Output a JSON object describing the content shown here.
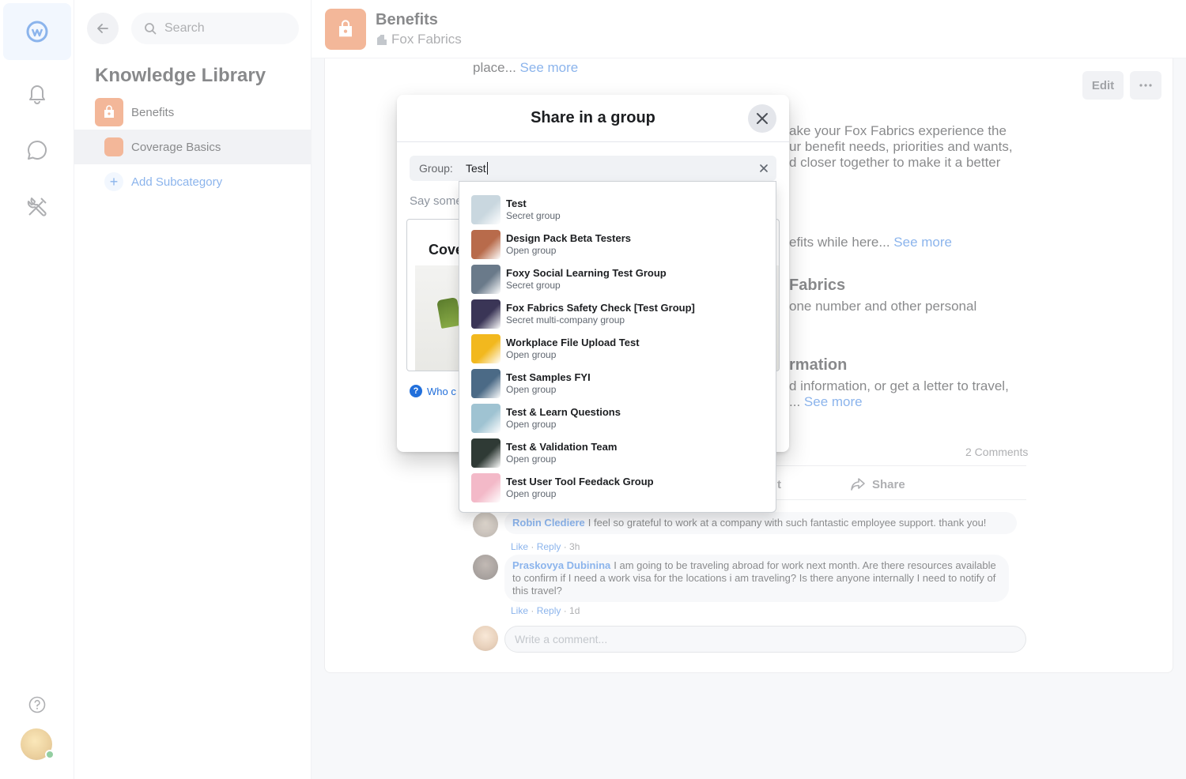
{
  "sidebar": {
    "search_placeholder": "Search",
    "library_title": "Knowledge Library",
    "categories": [
      {
        "label": "Benefits"
      },
      {
        "label": "Coverage Basics"
      }
    ],
    "add_label": "Add Subcategory"
  },
  "header": {
    "title": "Benefits",
    "company": "Fox Fabrics"
  },
  "article": {
    "line1": "place...",
    "see_more": "See more",
    "edit_label": "Edit",
    "para1_l1": "ake your Fox Fabrics experience the",
    "para1_l2": "ur benefit needs, priorities and wants,",
    "para1_l3": "d closer together to make it a better",
    "para2": "efits while here...",
    "section2_title": "Fabrics",
    "section2_text": "one number and other personal",
    "section3_title": "rmation",
    "section3_l1": "d information, or get a letter to travel,",
    "section3_l2": "...",
    "comments_count": "2 Comments",
    "action_partial": "t",
    "share_label": "Share"
  },
  "comments": [
    {
      "author": "Robin Clediere",
      "text": "I feel so grateful to work at a company with such fantastic employee support. thank you!",
      "like": "Like",
      "reply": "Reply",
      "time": "3h"
    },
    {
      "author": "Praskovya Dubinina",
      "text": "I am going to be traveling abroad for work next month. Are there resources available to confirm if I need a work visa for the locations i am traveling? Is there anyone internally I need to notify of this travel?",
      "like": "Like",
      "reply": "Reply",
      "time": "1d"
    }
  ],
  "write_placeholder": "Write a comment...",
  "modal": {
    "title": "Share in a group",
    "group_label": "Group:",
    "group_value": "Test",
    "say_placeholder": "Say some",
    "preview_title": "Cove",
    "who_label": "Who c"
  },
  "dropdown": {
    "options": [
      {
        "name": "Test",
        "type": "Secret group",
        "color": "#c9d7df"
      },
      {
        "name": "Design Pack Beta Testers",
        "type": "Open group",
        "color": "#b86b4b"
      },
      {
        "name": "Foxy Social Learning Test Group",
        "type": "Secret group",
        "color": "#6a7a8a"
      },
      {
        "name": "Fox Fabrics Safety Check [Test Group]",
        "type": "Secret multi-company group",
        "color": "#3a3556"
      },
      {
        "name": "Workplace File Upload Test",
        "type": "Open group",
        "color": "#f2b81e"
      },
      {
        "name": "Test Samples FYI",
        "type": "Open group",
        "color": "#4b6a86"
      },
      {
        "name": "Test & Learn Questions",
        "type": "Open group",
        "color": "#9fc3d2"
      },
      {
        "name": "Test & Validation Team",
        "type": "Open group",
        "color": "#2f3a35"
      },
      {
        "name": "Test User Tool Feedack Group",
        "type": "Open group",
        "color": "#f3b9c8"
      }
    ]
  }
}
